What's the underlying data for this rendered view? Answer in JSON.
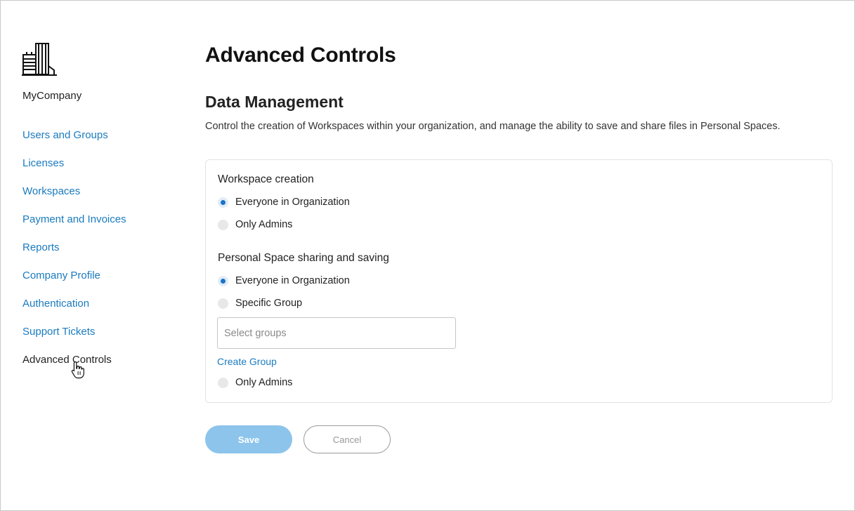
{
  "sidebar": {
    "logo_icon": "office-building-icon",
    "company_name": "MyCompany",
    "items": [
      {
        "label": "Users and Groups"
      },
      {
        "label": "Licenses"
      },
      {
        "label": "Workspaces"
      },
      {
        "label": "Payment and Invoices"
      },
      {
        "label": "Reports"
      },
      {
        "label": "Company Profile"
      },
      {
        "label": "Authentication"
      },
      {
        "label": "Support Tickets"
      },
      {
        "label": "Advanced Controls",
        "active": true
      }
    ]
  },
  "main": {
    "title": "Advanced Controls",
    "section": {
      "title": "Data Management",
      "description": "Control the creation of Workspaces within your organization, and manage the ability to save and share files in Personal Spaces."
    },
    "workspace_creation": {
      "label": "Workspace creation",
      "options": [
        {
          "label": "Everyone in Organization",
          "checked": true
        },
        {
          "label": "Only Admins",
          "checked": false
        }
      ]
    },
    "personal_space": {
      "label": "Personal Space sharing and saving",
      "options": [
        {
          "label": "Everyone in Organization",
          "checked": true
        },
        {
          "label": "Specific Group",
          "checked": false
        },
        {
          "label": "Only Admins",
          "checked": false
        }
      ],
      "select_placeholder": "Select groups",
      "create_group_label": "Create Group"
    },
    "buttons": {
      "save_label": "Save",
      "cancel_label": "Cancel"
    }
  },
  "colors": {
    "link": "#1a7bbf",
    "radio_checked": "#1a73c8",
    "save_button": "#8cc4ec"
  }
}
